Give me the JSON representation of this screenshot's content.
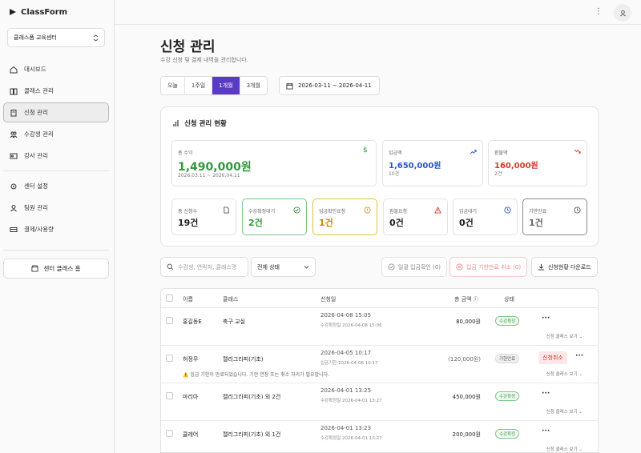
{
  "sidebar": {
    "logo": "ClassForm",
    "center": "클래스폼 교육센터",
    "items": [
      {
        "label": "대시보드",
        "icon": "home-icon"
      },
      {
        "label": "클래스 관리",
        "icon": "book-icon"
      },
      {
        "label": "신청 관리",
        "icon": "clipboard-icon",
        "active": true
      },
      {
        "label": "수강생 관리",
        "icon": "users-icon"
      },
      {
        "label": "강사 관리",
        "icon": "id-card-icon"
      },
      {
        "label": "센터 설정",
        "icon": "gear-icon"
      },
      {
        "label": "팀원 관리",
        "icon": "user-icon"
      },
      {
        "label": "결제/사용량",
        "icon": "credit-card-icon"
      }
    ],
    "home_button": "센터 클래스 홈"
  },
  "page": {
    "title": "신청 관리",
    "subtitle": "수강 신청 및 결제 내역을 관리합니다."
  },
  "period_tabs": [
    "오늘",
    "1주일",
    "1개월",
    "3개월"
  ],
  "active_period": "1개월",
  "date_range": "2026-03-11 ~ 2026-04-11",
  "summary": {
    "title": "신청 관리 현황",
    "revenue": {
      "label": "총 수익",
      "value": "1,490,000원",
      "range": "2026.03.11 ~ 2026.04.11"
    },
    "deposit": {
      "label": "입금액",
      "value": "1,650,000원",
      "count": "10건"
    },
    "refund": {
      "label": "환불액",
      "value": "160,000원",
      "count": "2건"
    },
    "counts": [
      {
        "label": "총 신청수",
        "value": "19건"
      },
      {
        "label": "수강확정대기",
        "value": "2건"
      },
      {
        "label": "입금확인요청",
        "value": "1건"
      },
      {
        "label": "환불요청",
        "value": "0건"
      },
      {
        "label": "입금대기",
        "value": "0건"
      },
      {
        "label": "기한만료",
        "value": "1건"
      }
    ]
  },
  "toolbar": {
    "search_placeholder": "수강생, 연락처, 클래스명",
    "status_select": "전체 상태",
    "bulk_confirm": "일괄 입금확인 (0)",
    "cancel_expired": "입금 기한만료 취소 (0)",
    "download": "신청현황 다운로드"
  },
  "table": {
    "headers": {
      "name": "이름",
      "class": "클래스",
      "date": "신청일",
      "amount": "총 금액",
      "status": "상태"
    },
    "rows": [
      {
        "name": "홍길동E",
        "class": "축구 교실",
        "date": "2026-04-08 15:05",
        "sub": "수강확정일 2026-04-08 15:06",
        "amount": "80,000원",
        "status": "수강확정",
        "link": "신청 클래스 보기"
      },
      {
        "name": "허정무",
        "class": "캘리그라피(기초)",
        "date": "2026-04-05 10:17",
        "sub": "입금기한 2026-04-06 10:17",
        "amount": "(120,000원)",
        "status": "기한만료",
        "action": "신청취소",
        "warning": "⚠️ 입금 기한이 만료되었습니다. 기한 연장 또는 취소 처리가 필요합니다.",
        "link": "신청 클래스 보기"
      },
      {
        "name": "마리아",
        "class": "캘리그라피(기초) 외 2건",
        "date": "2026-04-01 13:25",
        "sub": "수강확정일 2026-04-01 13:27",
        "amount": "450,000원",
        "status": "수강확정",
        "link": "신청 클래스 보기"
      },
      {
        "name": "클레어",
        "class": "캘리그라피(기초) 외 1건",
        "date": "2026-04-01 13:23",
        "sub": "수강확정일 2026-04-01 13:27",
        "amount": "200,000원",
        "status": "수강확정",
        "link": "신청 클래스 보기"
      }
    ]
  },
  "colors": {
    "accent": "#5a3cc4",
    "success": "#2e9a3a",
    "deposit": "#2a55c9",
    "refund": "#d83a2a"
  }
}
